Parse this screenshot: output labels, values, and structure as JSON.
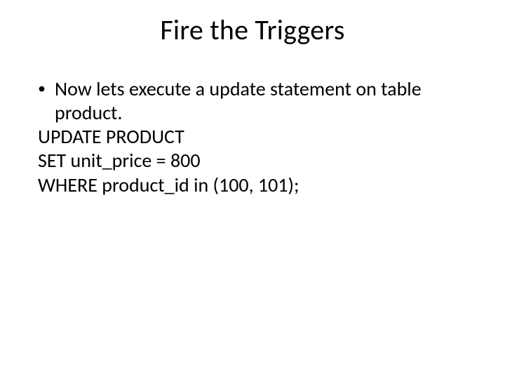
{
  "slide": {
    "title": "Fire the Triggers",
    "bullet": {
      "marker": "•",
      "text": "Now lets execute a update statement on table product."
    },
    "code": {
      "line1": "UPDATE PRODUCT",
      "line2": "SET unit_price = 800",
      "line3": "WHERE product_id in (100, 101);"
    }
  }
}
